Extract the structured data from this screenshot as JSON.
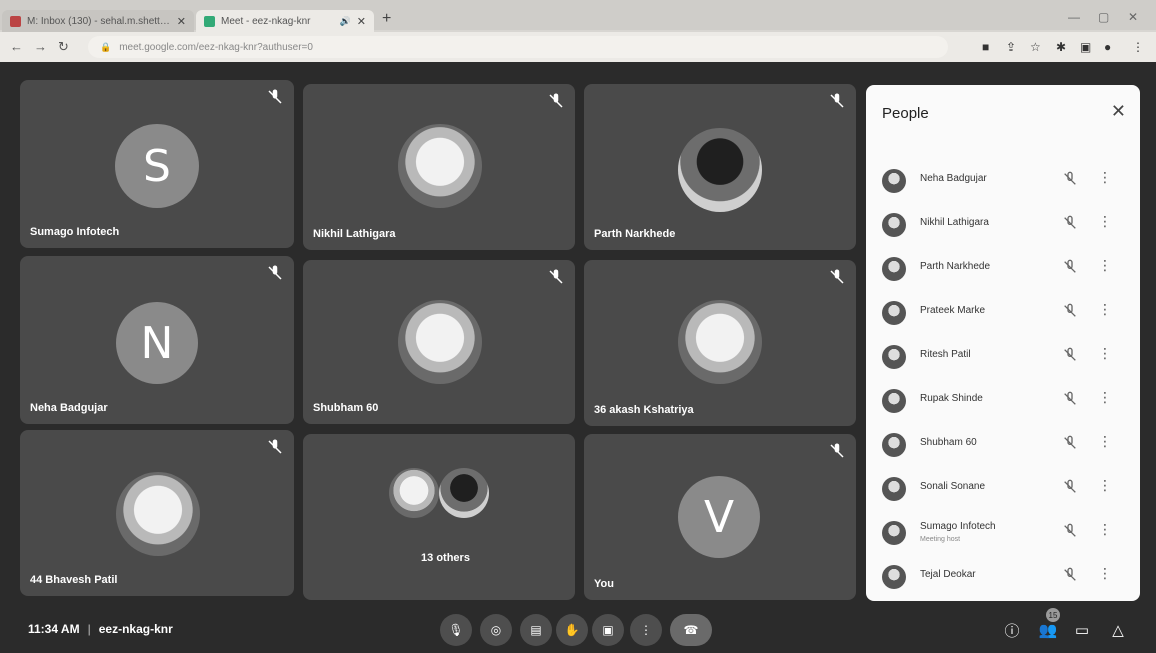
{
  "browser": {
    "tabs": [
      {
        "title": "M: Inbox (130) - sehal.m.shetti@ur...",
        "active": false
      },
      {
        "title": "Meet - eez-nkag-knr",
        "active": true
      }
    ],
    "new_tab": "+",
    "url": "meet.google.com/eez-nkag-knr?authuser=0"
  },
  "tiles": [
    {
      "name": "Sumago Infotech",
      "initial": "S",
      "avatar_color": "#8a8a8a"
    },
    {
      "name": "Nikhil Lathigara",
      "initial": "",
      "avatar_color": "#dcdcdc"
    },
    {
      "name": "Parth Narkhede",
      "initial": "",
      "avatar_color": "#777777"
    },
    {
      "name": "Neha Badgujar",
      "initial": "N",
      "avatar_color": "#8a8a8a"
    },
    {
      "name": "Shubham 60",
      "initial": "",
      "avatar_color": "#dcdcdc"
    },
    {
      "name": "36 akash Kshatriya",
      "initial": "",
      "avatar_color": "#cfcfcf"
    },
    {
      "name": "44 Bhavesh Patil",
      "initial": "",
      "avatar_color": "#8f8f8f"
    },
    {
      "name": "13 others",
      "initial": "",
      "avatar_color": "#bdbdbd"
    },
    {
      "name": "You",
      "initial": "V",
      "avatar_color": "#8a8a8a"
    }
  ],
  "people_panel": {
    "title": "People",
    "participants": [
      {
        "name": "Neha Badgujar",
        "sub": ""
      },
      {
        "name": "Nikhil Lathigara",
        "sub": ""
      },
      {
        "name": "Parth Narkhede",
        "sub": ""
      },
      {
        "name": "Prateek Marke",
        "sub": ""
      },
      {
        "name": "Ritesh Patil",
        "sub": ""
      },
      {
        "name": "Rupak Shinde",
        "sub": ""
      },
      {
        "name": "Shubham 60",
        "sub": ""
      },
      {
        "name": "Sonali Sonane",
        "sub": ""
      },
      {
        "name": "Sumago Infotech",
        "sub": "Meeting host"
      },
      {
        "name": "Tejal Deokar",
        "sub": ""
      }
    ]
  },
  "bottom": {
    "time": "11:34 AM",
    "separator": "|",
    "meeting_code": "eez-nkag-knr",
    "people_count": "15"
  },
  "icons": {
    "mic_off": "mic-off-icon",
    "camera_off": "camera-off-icon",
    "captions": "captions-icon",
    "raise_hand": "raise-hand-icon",
    "present": "present-icon",
    "more": "more-options-icon",
    "end_call": "end-call-icon",
    "info": "info-icon",
    "people": "people-icon",
    "chat": "chat-icon",
    "activities": "activities-icon"
  },
  "colors": {
    "stage_bg": "#2b2b2b",
    "tile_bg": "#4a4a4a",
    "panel_bg": "#fafafa"
  }
}
